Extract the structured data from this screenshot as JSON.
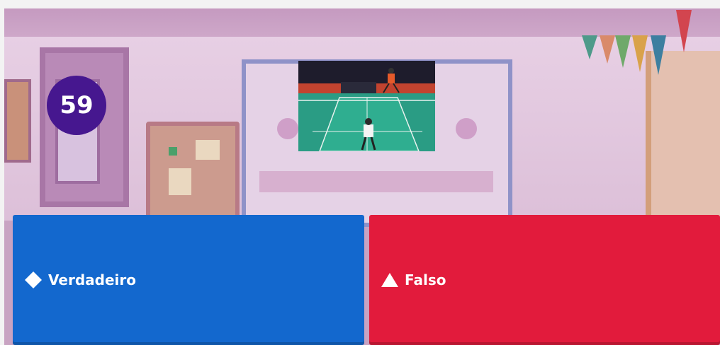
{
  "timer": {
    "seconds": "59",
    "color": "#46178f"
  },
  "media": {
    "content": "badminton-match-image"
  },
  "answers": [
    {
      "label": "Verdadeiro",
      "shape": "diamond-icon",
      "color": "#1368ce"
    },
    {
      "label": "Falso",
      "shape": "triangle-icon",
      "color": "#e21b3c"
    }
  ]
}
